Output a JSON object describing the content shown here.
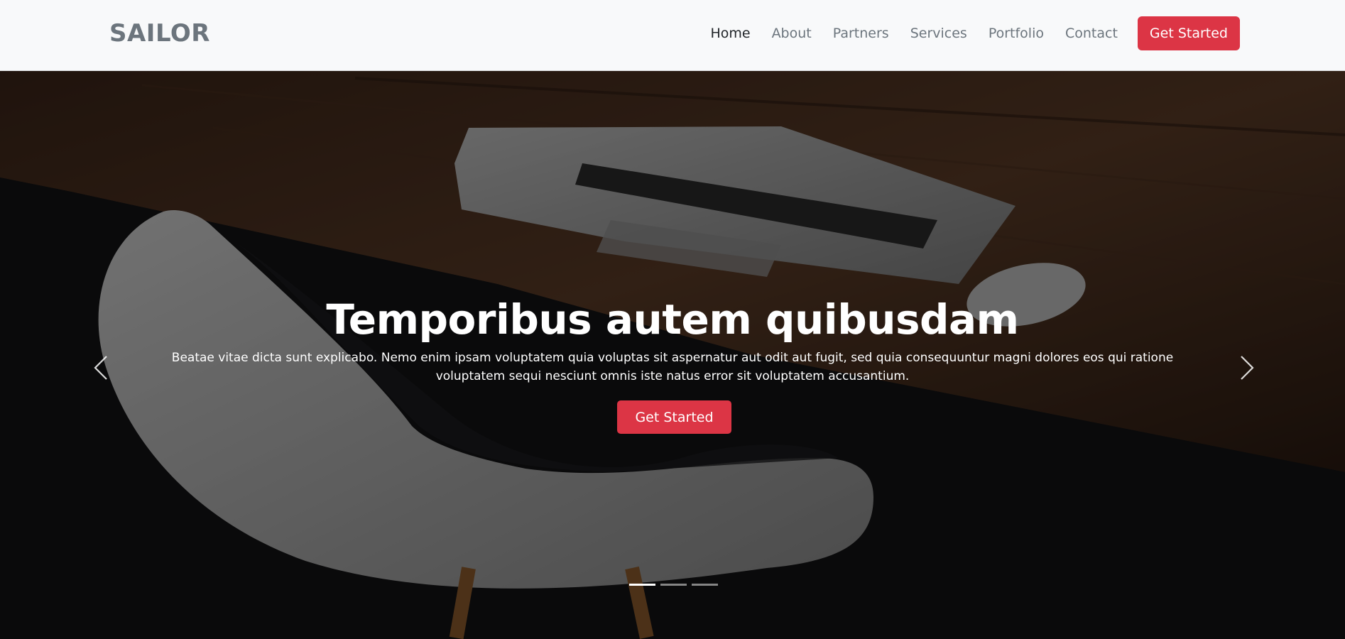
{
  "brand": {
    "logo": "SAILOR"
  },
  "nav": {
    "items": [
      {
        "label": "Home",
        "active": true
      },
      {
        "label": "About"
      },
      {
        "label": "Partners"
      },
      {
        "label": "Services"
      },
      {
        "label": "Portfolio"
      },
      {
        "label": "Contact"
      }
    ],
    "cta_label": "Get Started"
  },
  "hero": {
    "title": "Temporibus autem quibusdam",
    "text": "Beatae vitae dicta sunt explicabo. Nemo enim ipsam voluptatem quia voluptas sit aspernatur aut odit aut fugit, sed quia consequuntur magni dolores eos qui ratione voluptatem sequi nesciunt omnis iste natus error sit voluptatem accusantium.",
    "cta_label": "Get Started",
    "slides_total": 3,
    "active_slide": 1
  },
  "colors": {
    "accent": "#dc3545",
    "header_bg": "#f8f9fa",
    "nav_text": "#6c757d",
    "nav_active": "#212529"
  },
  "icons": {
    "prev": "chevron-left-icon",
    "next": "chevron-right-icon"
  }
}
